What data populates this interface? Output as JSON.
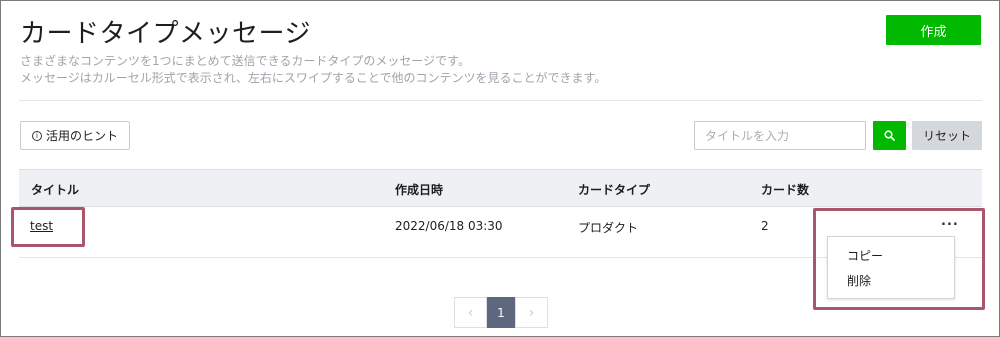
{
  "page": {
    "title": "カードタイプメッセージ",
    "description_line1": "さまざまなコンテンツを1つにまとめて送信できるカードタイプのメッセージです。",
    "description_line2": "メッセージはカルーセル形式で表示され、左右にスワイプすることで他のコンテンツを見ることができます。"
  },
  "toolbar": {
    "create_label": "作成",
    "hint_label": "活用のヒント",
    "hint_icon": "info-icon",
    "search_placeholder": "タイトルを入力",
    "search_value": "",
    "search_icon": "search-icon",
    "reset_label": "リセット"
  },
  "table": {
    "columns": [
      "タイトル",
      "作成日時",
      "カードタイプ",
      "カード数"
    ],
    "rows": [
      {
        "title": "test",
        "created": "2022/06/18 03:30",
        "card_type": "プロダクト",
        "card_count": "2",
        "more_label": "..."
      }
    ]
  },
  "row_menu": {
    "items": [
      "コピー",
      "削除"
    ]
  },
  "pagination": {
    "prev_label": "‹",
    "current_page": "1",
    "next_label": "›"
  },
  "colors": {
    "accent_green": "#00b900",
    "highlight_border": "#a8566b",
    "page_active": "#5e677e"
  }
}
